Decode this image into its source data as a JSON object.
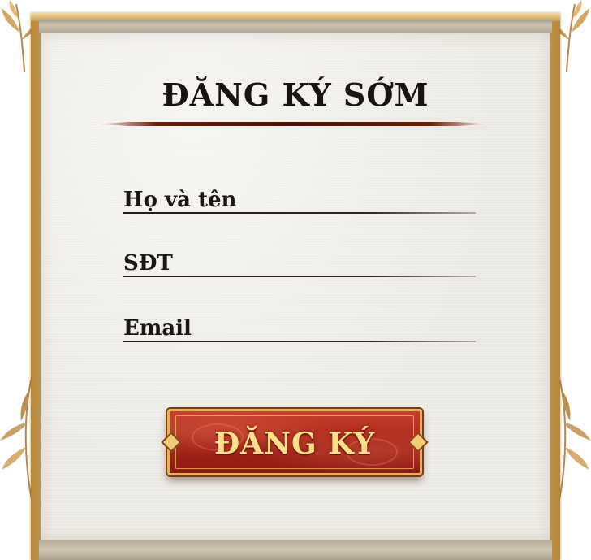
{
  "form": {
    "title": "ĐĂNG KÝ SỚM",
    "fields": [
      {
        "label": "Họ và tên",
        "value": ""
      },
      {
        "label": "SĐT",
        "value": ""
      },
      {
        "label": "Email",
        "value": ""
      }
    ],
    "submit_label": "ĐĂNG KÝ"
  },
  "colors": {
    "frame_gold": "#d9ad5f",
    "paper": "#efede7",
    "button_red": "#a8251a",
    "button_text": "#ffe08a",
    "title_rule": "#6e1e0a"
  },
  "icons": [
    "bamboo-leaf-icon",
    "diamond-ornament-icon"
  ]
}
